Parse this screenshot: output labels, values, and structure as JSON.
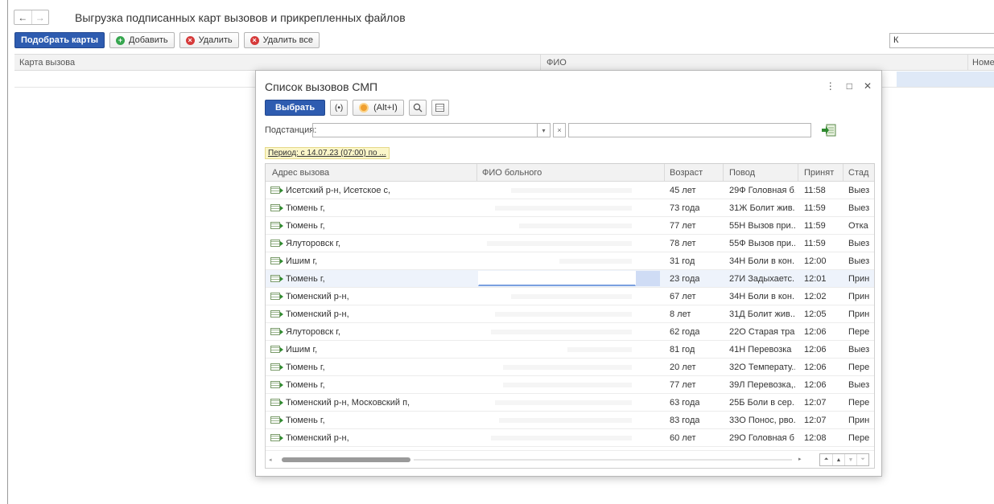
{
  "page": {
    "title": "Выгрузка подписанных карт вызовов и прикрепленных файлов",
    "nav_back": "←",
    "nav_forward": "→"
  },
  "toolbar": {
    "pick_cards": "Подобрать карты",
    "add": "Добавить",
    "delete": "Удалить",
    "delete_all": "Удалить все",
    "search_value": "К"
  },
  "main_table": {
    "columns": [
      "Карта вызова",
      "ФИО",
      "Номе"
    ]
  },
  "dialog": {
    "title": "Список вызовов СМП",
    "controls": {
      "menu": "⋮",
      "maximize": "□",
      "close": "✕"
    },
    "toolbar": {
      "select": "Выбрать",
      "radio_label": "(•)",
      "hotkey": "(Alt+I)",
      "search_icon": "search-icon",
      "calendar_icon": "calendar-icon"
    },
    "substation_label": "Подстанция:",
    "dropdown_glyph": "▾",
    "clear_glyph": "×",
    "period": "Период: с 14.07.23 (07:00)  по ...",
    "columns": [
      "Адрес вызова",
      "ФИО больного",
      "Возраст",
      "Повод",
      "Принят",
      "Стад"
    ],
    "rows": [
      {
        "address": "Исетский р-н, Исетское с,",
        "age": "45 лет",
        "reason": "29Ф Головная б...",
        "time": "11:58",
        "stage": "Выез"
      },
      {
        "address": "Тюмень г,",
        "age": "73 года",
        "reason": "31Ж Болит жив...",
        "time": "11:59",
        "stage": "Выез"
      },
      {
        "address": "Тюмень г,",
        "age": "77 лет",
        "reason": "55Н Вызов при...",
        "time": "11:59",
        "stage": "Отка"
      },
      {
        "address": "Ялуторовск г,",
        "age": "78 лет",
        "reason": "55Ф Вызов при...",
        "time": "11:59",
        "stage": "Выез"
      },
      {
        "address": "Ишим г,",
        "age": "31 год",
        "reason": "34Н Боли в кон...",
        "time": "12:00",
        "stage": "Выез"
      },
      {
        "address": "Тюмень г,",
        "age": "23 года",
        "reason": "27И Задыхаетс...",
        "time": "12:01",
        "stage": "Прин"
      },
      {
        "address": "Тюменский р-н,",
        "age": "67 лет",
        "reason": "34Н Боли в кон...",
        "time": "12:02",
        "stage": "Прин"
      },
      {
        "address": "Тюменский р-н,",
        "age": "8 лет",
        "reason": "31Д Болит жив...",
        "time": "12:05",
        "stage": "Прин"
      },
      {
        "address": "Ялуторовск г,",
        "age": "62 года",
        "reason": "22О Старая тра...",
        "time": "12:06",
        "stage": "Пере"
      },
      {
        "address": "Ишим г,",
        "age": "81 год",
        "reason": "41Н Перевозка",
        "time": "12:06",
        "stage": "Выез"
      },
      {
        "address": "Тюмень г,",
        "age": "20 лет",
        "reason": "32О Температу...",
        "time": "12:06",
        "stage": "Пере"
      },
      {
        "address": "Тюмень г,",
        "age": "77 лет",
        "reason": "39Л Перевозка,...",
        "time": "12:06",
        "stage": "Выез"
      },
      {
        "address": "Тюменский р-н, Московский п,",
        "age": "63 года",
        "reason": "25Б Боли в сер...",
        "time": "12:07",
        "stage": "Пере"
      },
      {
        "address": "Тюмень г,",
        "age": "83 года",
        "reason": "33О Понос, рво...",
        "time": "12:07",
        "stage": "Прин"
      },
      {
        "address": "Тюменский р-н,",
        "age": "60 лет",
        "reason": "29О Головная б...",
        "time": "12:08",
        "stage": "Пере"
      }
    ],
    "selected_row": 5,
    "pager": [
      "⏶",
      "▲",
      "▼",
      "⏷"
    ]
  }
}
